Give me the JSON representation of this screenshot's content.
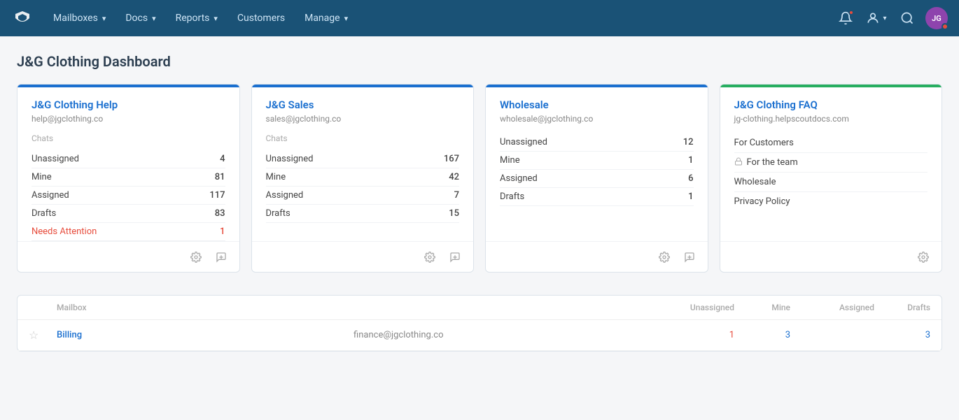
{
  "nav": {
    "brand_icon": "✦",
    "items": [
      {
        "label": "Mailboxes",
        "has_dropdown": true
      },
      {
        "label": "Docs",
        "has_dropdown": true
      },
      {
        "label": "Reports",
        "has_dropdown": true
      },
      {
        "label": "Customers",
        "has_dropdown": false
      },
      {
        "label": "Manage",
        "has_dropdown": true
      }
    ],
    "right_icons": {
      "notifications": "🔔",
      "user_menu": "👤",
      "search": "🔍",
      "avatar_initials": "JG"
    }
  },
  "page": {
    "title": "J&G Clothing Dashboard"
  },
  "cards": [
    {
      "id": "jg-help",
      "title": "J&G Clothing Help",
      "email": "help@jgclothing.co",
      "accent_color": "#1a6fcf",
      "type": "mailbox",
      "section_label": "Chats",
      "rows": [
        {
          "label": "Unassigned",
          "count": "4",
          "attention": false
        },
        {
          "label": "Mine",
          "count": "81",
          "attention": false
        },
        {
          "label": "Assigned",
          "count": "117",
          "attention": false
        },
        {
          "label": "Drafts",
          "count": "83",
          "attention": false
        },
        {
          "label": "Needs Attention",
          "count": "1",
          "attention": true
        }
      ],
      "show_new_conversation": true
    },
    {
      "id": "jg-sales",
      "title": "J&G Sales",
      "email": "sales@jgclothing.co",
      "accent_color": "#1a6fcf",
      "type": "mailbox",
      "section_label": "Chats",
      "rows": [
        {
          "label": "Unassigned",
          "count": "167",
          "attention": false
        },
        {
          "label": "Mine",
          "count": "42",
          "attention": false
        },
        {
          "label": "Assigned",
          "count": "7",
          "attention": false
        },
        {
          "label": "Drafts",
          "count": "15",
          "attention": false
        }
      ],
      "show_new_conversation": true
    },
    {
      "id": "wholesale",
      "title": "Wholesale",
      "email": "wholesale@jgclothing.co",
      "accent_color": "#1a6fcf",
      "type": "mailbox",
      "section_label": "",
      "rows": [
        {
          "label": "Unassigned",
          "count": "12",
          "attention": false
        },
        {
          "label": "Mine",
          "count": "1",
          "attention": false
        },
        {
          "label": "Assigned",
          "count": "6",
          "attention": false
        },
        {
          "label": "Drafts",
          "count": "1",
          "attention": false
        }
      ],
      "show_new_conversation": true
    },
    {
      "id": "jg-faq",
      "title": "J&G Clothing FAQ",
      "email": "jg-clothing.helpscoutdocs.com",
      "accent_color": "#27ae60",
      "type": "docs",
      "links": [
        {
          "label": "For Customers",
          "locked": false
        },
        {
          "label": "For the team",
          "locked": true
        },
        {
          "label": "Wholesale",
          "locked": false
        },
        {
          "label": "Privacy Policy",
          "locked": false
        }
      ],
      "show_new_conversation": false
    }
  ],
  "table": {
    "headers": {
      "star": "",
      "mailbox": "Mailbox",
      "email": "",
      "unassigned": "Unassigned",
      "mine": "Mine",
      "assigned": "Assigned",
      "drafts": "Drafts"
    },
    "rows": [
      {
        "starred": false,
        "name": "Billing",
        "email": "finance@jgclothing.co",
        "unassigned": "1",
        "mine": "3",
        "assigned": "",
        "drafts": "3"
      }
    ]
  },
  "icons": {
    "gear": "⚙",
    "new_conversation": "💬",
    "lock": "🔒",
    "star_empty": "☆",
    "chevron_down": "▾",
    "bell": "🔔",
    "search": "🔍"
  }
}
